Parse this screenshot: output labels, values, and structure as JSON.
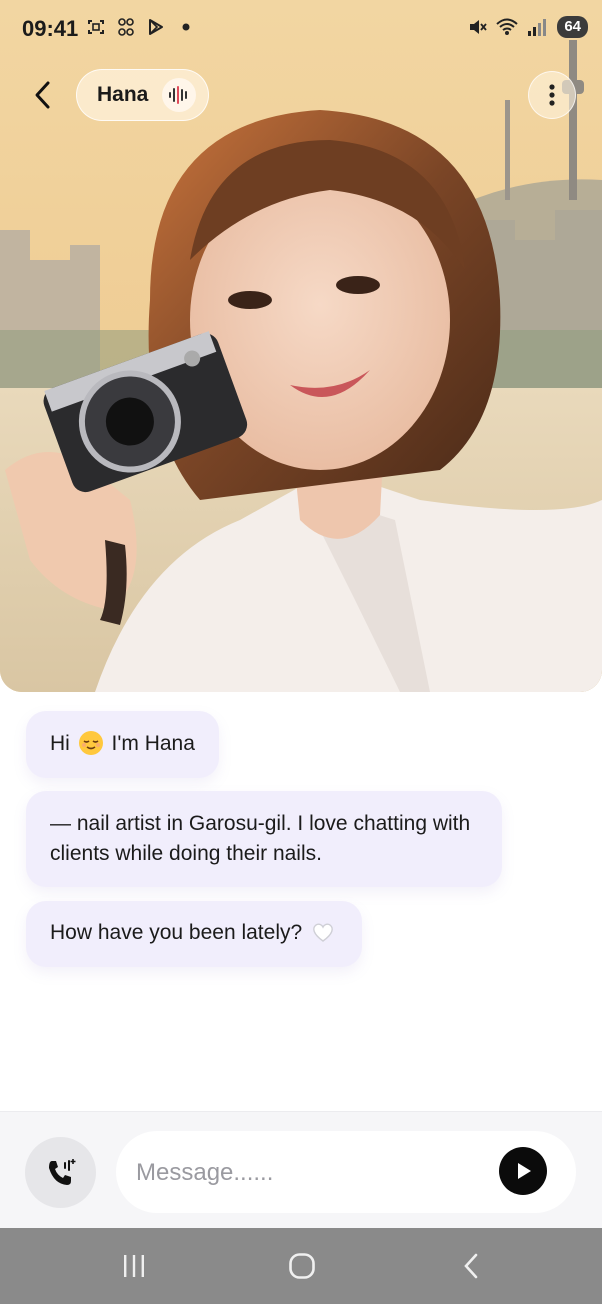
{
  "status_bar": {
    "time": "09:41",
    "battery": "64",
    "icons_left": [
      "screenshot-icon",
      "scan-icon",
      "play-store-icon",
      "dot-icon"
    ],
    "icons_right": [
      "mute-icon",
      "wifi-icon",
      "signal-icon",
      "battery-icon"
    ]
  },
  "header": {
    "name": "Hana",
    "back_icon": "chevron-left-icon",
    "voice_icon": "voice-wave-icon",
    "more_icon": "more-vertical-icon"
  },
  "messages": [
    {
      "before": "Hi",
      "emoji": "relieved-face-emoji",
      "after": "I'm Hana"
    },
    {
      "text": "— nail artist in Garosu-gil. I love chatting with clients while doing their nails."
    },
    {
      "text": "How have you been lately?",
      "emoji": "white-heart-emoji"
    }
  ],
  "composer": {
    "placeholder": "Message......",
    "call_icon": "phone-call-icon",
    "send_icon": "send-play-icon"
  },
  "colors": {
    "bubble": "#f1eefc",
    "send": "#0b0b0b",
    "navbar": "#8a8a8a"
  }
}
